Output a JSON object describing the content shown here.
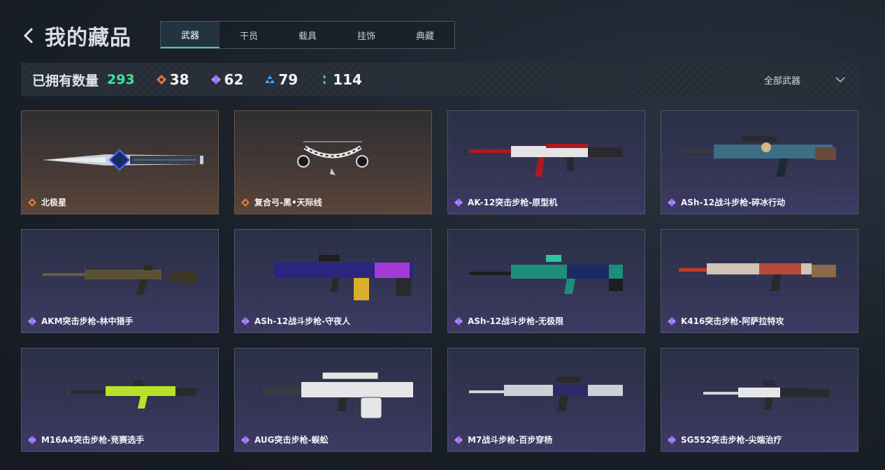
{
  "header": {
    "title": "我的藏品"
  },
  "tabs": [
    {
      "label": "武器",
      "active": true
    },
    {
      "label": "干员",
      "active": false
    },
    {
      "label": "载具",
      "active": false
    },
    {
      "label": "挂饰",
      "active": false
    },
    {
      "label": "典藏",
      "active": false
    }
  ],
  "stats": {
    "owned_label": "已拥有数量",
    "owned_count": "293",
    "rarities": [
      {
        "icon": "orange-diamond-icon",
        "color": "#e07a3c",
        "count": "38"
      },
      {
        "icon": "purple-diamond-icon",
        "color": "#9b6bff",
        "count": "62"
      },
      {
        "icon": "blue-triangle-icon",
        "color": "#4aa3f0",
        "count": "79"
      },
      {
        "icon": "green-dots-icon",
        "color": "#3fd19a",
        "count": "114"
      }
    ]
  },
  "filter": {
    "label": "全部武器"
  },
  "colors": {
    "accent": "#3fe39a",
    "orange": "#e07a3c",
    "purple": "#9b6bff"
  },
  "items": [
    {
      "name": "北极星",
      "rarity": "orange"
    },
    {
      "name": "复合弓-黑•天际线",
      "rarity": "orange"
    },
    {
      "name": "AK-12突击步枪-原型机",
      "rarity": "purple"
    },
    {
      "name": "ASh-12战斗步枪-碎冰行动",
      "rarity": "purple"
    },
    {
      "name": "AKM突击步枪-林中猎手",
      "rarity": "purple"
    },
    {
      "name": "ASh-12战斗步枪-守夜人",
      "rarity": "purple"
    },
    {
      "name": "ASh-12战斗步枪-无极限",
      "rarity": "purple"
    },
    {
      "name": "K416突击步枪-阿萨拉特攻",
      "rarity": "purple"
    },
    {
      "name": "M16A4突击步枪-竞赛选手",
      "rarity": "purple"
    },
    {
      "name": "AUG突击步枪-蜈蚣",
      "rarity": "purple"
    },
    {
      "name": "M7战斗步枪-百步穿杨",
      "rarity": "purple"
    },
    {
      "name": "SG552突击步枪-尖端治疗",
      "rarity": "purple"
    }
  ]
}
